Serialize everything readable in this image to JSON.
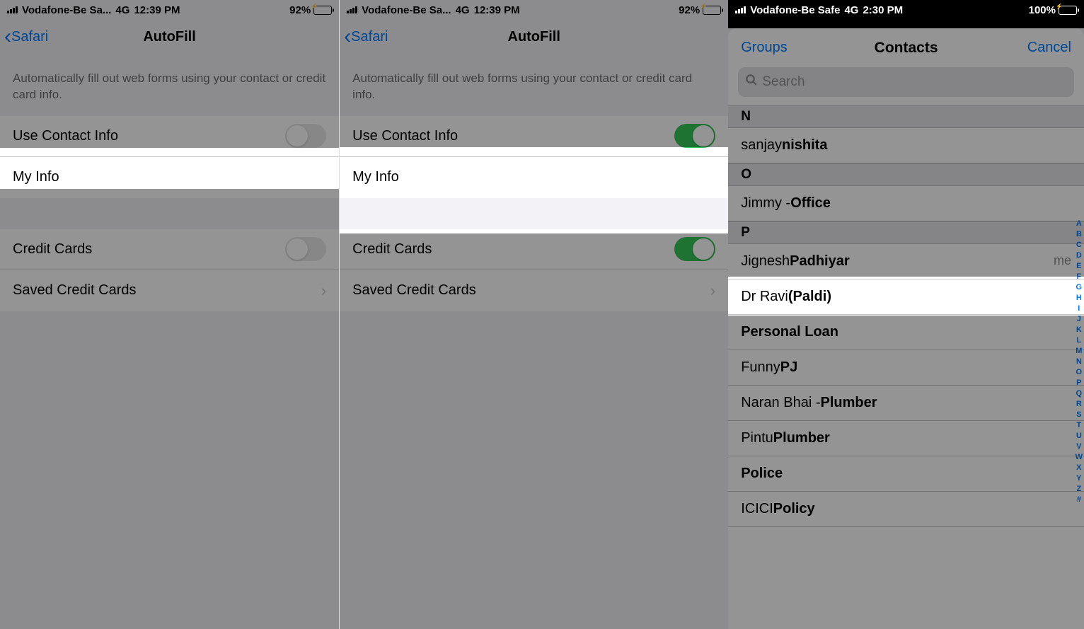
{
  "status": {
    "carrier_short": "Vodafone-Be Sa...",
    "carrier_full": "Vodafone-Be Safe",
    "network": "4G",
    "time1": "12:39 PM",
    "time2": "2:30 PM",
    "battery1": "92%",
    "battery2": "100%"
  },
  "autofill": {
    "back": "Safari",
    "title": "AutoFill",
    "desc": "Automatically fill out web forms using your contact or credit card info.",
    "use_contact": "Use Contact Info",
    "my_info": "My Info",
    "credit_cards": "Credit Cards",
    "saved_cards": "Saved Credit Cards"
  },
  "contacts": {
    "groups": "Groups",
    "title": "Contacts",
    "cancel": "Cancel",
    "search": "Search",
    "me": "me",
    "sections": {
      "N": [
        {
          "first": "sanjay ",
          "last": "nishita"
        }
      ],
      "O": [
        {
          "first": "Jimmy - ",
          "last": "Office"
        }
      ],
      "P": [
        {
          "first": "Jignesh ",
          "last": "Padhiyar",
          "me": true
        },
        {
          "first": "Dr Ravi ",
          "last": "(Paldi)"
        },
        {
          "first": "",
          "last": "Personal Loan"
        },
        {
          "first": "Funny ",
          "last": "PJ"
        },
        {
          "first": "Naran Bhai - ",
          "last": "Plumber"
        },
        {
          "first": "Pintu ",
          "last": "Plumber"
        },
        {
          "first": "",
          "last": "Police"
        },
        {
          "first": "ICICI ",
          "last": "Policy"
        }
      ]
    },
    "index": [
      "A",
      "B",
      "C",
      "D",
      "E",
      "F",
      "G",
      "H",
      "I",
      "J",
      "K",
      "L",
      "M",
      "N",
      "O",
      "P",
      "Q",
      "R",
      "S",
      "T",
      "U",
      "V",
      "W",
      "X",
      "Y",
      "Z",
      "#"
    ]
  }
}
